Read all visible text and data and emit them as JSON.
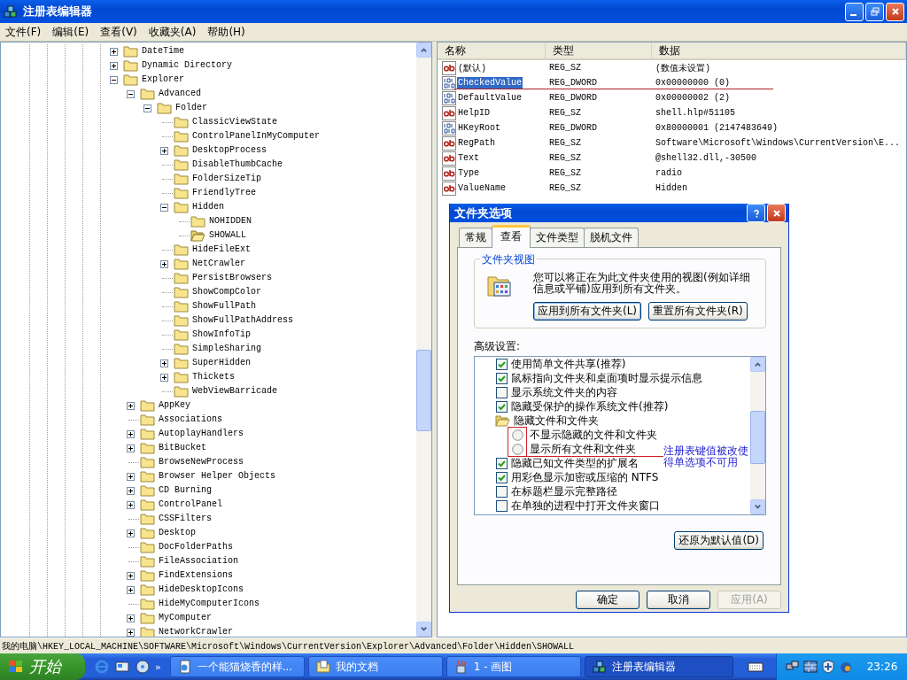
{
  "window": {
    "title": "注册表编辑器"
  },
  "menu": [
    "文件(F)",
    "编辑(E)",
    "查看(V)",
    "收藏夹(A)",
    "帮助(H)"
  ],
  "tree": {
    "items": [
      {
        "label": "DateTime",
        "expanded": false,
        "selected": false
      },
      {
        "label": "Dynamic Directory",
        "expanded": false,
        "selected": false
      },
      {
        "label": "Explorer",
        "expanded": true,
        "selected": false,
        "children": [
          {
            "label": "Advanced",
            "expanded": true,
            "selected": false,
            "children": [
              {
                "label": "Folder",
                "expanded": true,
                "selected": false,
                "children": [
                  {
                    "label": "ClassicViewState",
                    "selected": false
                  },
                  {
                    "label": "ControlPanelInMyComputer",
                    "selected": false
                  },
                  {
                    "label": "DesktopProcess",
                    "expanded": false,
                    "selected": false
                  },
                  {
                    "label": "DisableThumbCache",
                    "selected": false
                  },
                  {
                    "label": "FolderSizeTip",
                    "selected": false
                  },
                  {
                    "label": "FriendlyTree",
                    "selected": false
                  },
                  {
                    "label": "Hidden",
                    "expanded": true,
                    "selected": false,
                    "children": [
                      {
                        "label": "NOHIDDEN",
                        "selected": false
                      },
                      {
                        "label": "SHOWALL",
                        "selected": true
                      }
                    ]
                  },
                  {
                    "label": "HideFileExt",
                    "selected": false
                  },
                  {
                    "label": "NetCrawler",
                    "expanded": false,
                    "selected": false
                  },
                  {
                    "label": "PersistBrowsers",
                    "selected": false
                  },
                  {
                    "label": "ShowCompColor",
                    "selected": false
                  },
                  {
                    "label": "ShowFullPath",
                    "selected": false
                  },
                  {
                    "label": "ShowFullPathAddress",
                    "selected": false
                  },
                  {
                    "label": "ShowInfoTip",
                    "selected": false
                  },
                  {
                    "label": "SimpleSharing",
                    "selected": false
                  },
                  {
                    "label": "SuperHidden",
                    "expanded": false,
                    "selected": false
                  },
                  {
                    "label": "Thickets",
                    "expanded": false,
                    "selected": false
                  },
                  {
                    "label": "WebViewBarricade",
                    "selected": false
                  }
                ]
              }
            ]
          },
          {
            "label": "AppKey",
            "expanded": false,
            "selected": false
          },
          {
            "label": "Associations",
            "selected": false
          },
          {
            "label": "AutoplayHandlers",
            "expanded": false,
            "selected": false
          },
          {
            "label": "BitBucket",
            "expanded": false,
            "selected": false
          },
          {
            "label": "BrowseNewProcess",
            "selected": false
          },
          {
            "label": "Browser Helper Objects",
            "expanded": false,
            "selected": false
          },
          {
            "label": "CD Burning",
            "expanded": false,
            "selected": false
          },
          {
            "label": "ControlPanel",
            "expanded": false,
            "selected": false
          },
          {
            "label": "CSSFilters",
            "selected": false
          },
          {
            "label": "Desktop",
            "expanded": false,
            "selected": false
          },
          {
            "label": "DocFolderPaths",
            "selected": false
          },
          {
            "label": "FileAssociation",
            "selected": false
          },
          {
            "label": "FindExtensions",
            "expanded": false,
            "selected": false
          },
          {
            "label": "HideDesktopIcons",
            "expanded": false,
            "selected": false
          },
          {
            "label": "HideMyComputerIcons",
            "selected": false
          },
          {
            "label": "MyComputer",
            "expanded": false,
            "selected": false
          },
          {
            "label": "NetworkCrawler",
            "expanded": false,
            "selected": false
          }
        ]
      }
    ]
  },
  "values": {
    "columns": [
      "名称",
      "类型",
      "数据"
    ],
    "rows": [
      {
        "kind": "string",
        "name": "(默认)",
        "type": "REG_SZ",
        "data": "(数值未设置)",
        "selected": false
      },
      {
        "kind": "dword",
        "name": "CheckedValue",
        "type": "REG_DWORD",
        "data": "0x00000000 (0)",
        "selected": true
      },
      {
        "kind": "dword",
        "name": "DefaultValue",
        "type": "REG_DWORD",
        "data": "0x00000002 (2)",
        "selected": false
      },
      {
        "kind": "string",
        "name": "HelpID",
        "type": "REG_SZ",
        "data": "shell.hlp#51105",
        "selected": false
      },
      {
        "kind": "dword",
        "name": "HKeyRoot",
        "type": "REG_DWORD",
        "data": "0x80000001 (2147483649)",
        "selected": false
      },
      {
        "kind": "string",
        "name": "RegPath",
        "type": "REG_SZ",
        "data": "Software\\Microsoft\\Windows\\CurrentVersion\\E...",
        "selected": false
      },
      {
        "kind": "string",
        "name": "Text",
        "type": "REG_SZ",
        "data": "@shell32.dll,-30500",
        "selected": false
      },
      {
        "kind": "string",
        "name": "Type",
        "type": "REG_SZ",
        "data": "radio",
        "selected": false
      },
      {
        "kind": "string",
        "name": "ValueName",
        "type": "REG_SZ",
        "data": "Hidden",
        "selected": false
      }
    ]
  },
  "dialog": {
    "title": "文件夹选项",
    "tabs": [
      {
        "label": "常规",
        "selected": false
      },
      {
        "label": "查看",
        "selected": true
      },
      {
        "label": "文件类型",
        "selected": false
      },
      {
        "label": "脱机文件",
        "selected": false
      }
    ],
    "group_title": "文件夹视图",
    "group_text": "您可以将正在为此文件夹使用的视图(例如详细信息或平铺)应用到所有文件夹。",
    "group_buttons": [
      {
        "label": "应用到所有文件夹(L)",
        "focused": true
      },
      {
        "label": "重置所有文件夹(R)",
        "focused": false
      }
    ],
    "advanced_label": "高级设置:",
    "settings": [
      {
        "kind": "checkbox",
        "label": "使用简单文件共享(推荐)",
        "checked": true
      },
      {
        "kind": "checkbox",
        "label": "鼠标指向文件夹和桌面项时显示提示信息",
        "checked": true
      },
      {
        "kind": "checkbox",
        "label": "显示系统文件夹的内容",
        "checked": false
      },
      {
        "kind": "checkbox",
        "label": "隐藏受保护的操作系统文件(推荐)",
        "checked": true
      },
      {
        "kind": "group",
        "label": "隐藏文件和文件夹"
      },
      {
        "kind": "radio",
        "label": "不显示隐藏的文件和文件夹",
        "selected": false
      },
      {
        "kind": "radio",
        "label": "显示所有文件和文件夹",
        "selected": false
      },
      {
        "kind": "checkbox",
        "label": "隐藏已知文件类型的扩展名",
        "checked": true
      },
      {
        "kind": "checkbox",
        "label": "用彩色显示加密或压缩的 NTFS",
        "checked": true
      },
      {
        "kind": "checkbox",
        "label": "在标题栏显示完整路径",
        "checked": false
      },
      {
        "kind": "checkbox",
        "label": "在单独的进程中打开文件夹窗口",
        "checked": false
      }
    ],
    "annotation": "注册表键值被改使得单选项不可用",
    "restore_button": "还原为默认值(D)",
    "buttons": [
      {
        "label": "确定",
        "disabled": false
      },
      {
        "label": "取消",
        "disabled": false
      },
      {
        "label": "应用(A)",
        "disabled": true
      }
    ]
  },
  "status_bar": "我的电脑\\HKEY_LOCAL_MACHINE\\SOFTWARE\\Microsoft\\Windows\\CurrentVersion\\Explorer\\Advanced\\Folder\\Hidden\\SHOWALL",
  "taskbar": {
    "start": "开始",
    "quick_launch_more": "»",
    "tasks": [
      {
        "label": "一个能猫烧香的样...",
        "kind": "document",
        "selected": false
      },
      {
        "label": "我的文档",
        "kind": "folder",
        "selected": false
      },
      {
        "label": "1 - 画图",
        "kind": "paint",
        "selected": false
      },
      {
        "label": "注册表编辑器",
        "kind": "registry",
        "selected": true
      }
    ],
    "clock": "23:26"
  }
}
